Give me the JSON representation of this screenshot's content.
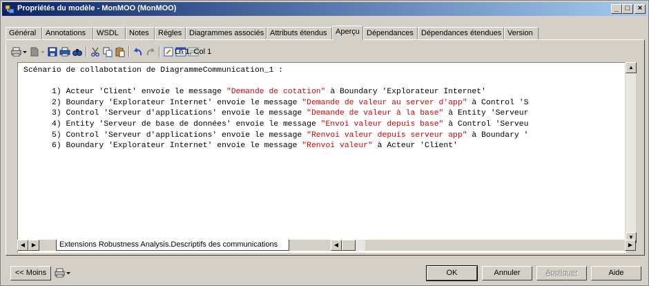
{
  "window": {
    "title": "Propriétés du modèle - MonMOO (MonMOO)",
    "controls": {
      "minimize": "_",
      "maximize": "□",
      "close": "×"
    }
  },
  "tabs": [
    {
      "label": "Général"
    },
    {
      "label": "Annotations"
    },
    {
      "label": "WSDL"
    },
    {
      "label": "Notes"
    },
    {
      "label": "Règles"
    },
    {
      "label": "Diagrammes associés"
    },
    {
      "label": "Attributs étendus"
    },
    {
      "label": "Aperçu"
    },
    {
      "label": "Dépendances"
    },
    {
      "label": "Dépendances étendues"
    },
    {
      "label": "Version"
    }
  ],
  "toolbar": {
    "icons": [
      "print-menu-icon",
      "new-menu-icon",
      "save-icon",
      "print-icon",
      "find-icon",
      "cut-icon",
      "copy-icon",
      "paste-icon",
      "undo-icon",
      "redo-icon",
      "edit-icon",
      "view-icon",
      "properties-icon"
    ],
    "status": "Ln 1, Col 1"
  },
  "editor": {
    "heading": "Scénario de collabotation de DiagrammeCommunication_1 :",
    "lines": [
      {
        "a": "1) Acteur 'Client' envoie le message ",
        "msg": "\"Demande de cotation\"",
        "b": " à Boundary 'Explorateur Internet'"
      },
      {
        "a": "2) Boundary 'Explorateur Internet' envoie le message ",
        "msg": "\"Demande de valeur au server d'app\"",
        "b": " à Control 'S"
      },
      {
        "a": "3) Control 'Serveur d'applications' envoie le message ",
        "msg": "\"Demande de valeur à la base\"",
        "b": " à Entity 'Serveur"
      },
      {
        "a": "4) Entity 'Serveur de base de données' envoie le message ",
        "msg": "\"Envoi valeur depuis base\"",
        "b": " à Control 'Serveu"
      },
      {
        "a": "5) Control 'Serveur d'applications' envoie le message ",
        "msg": "\"Renvoi valeur depuis serveur app\"",
        "b": " à Boundary '"
      },
      {
        "a": "6) Boundary 'Explorateur Internet' envoie le message ",
        "msg": "\"Renvoi valeur\"",
        "b": " à Acteur 'Client'"
      }
    ],
    "message_color": "#e00000"
  },
  "sheet": {
    "tab_label": "Extensions Robustness Analysis.Descriptifs des communications"
  },
  "buttons": {
    "less": "<< Moins",
    "ok": "OK",
    "cancel": "Annuler",
    "apply": "Appliquer",
    "help": "Aide"
  },
  "colors": {
    "titlebar_start": "#0a246a",
    "titlebar_end": "#a6caf0",
    "face": "#d4d0c8"
  }
}
